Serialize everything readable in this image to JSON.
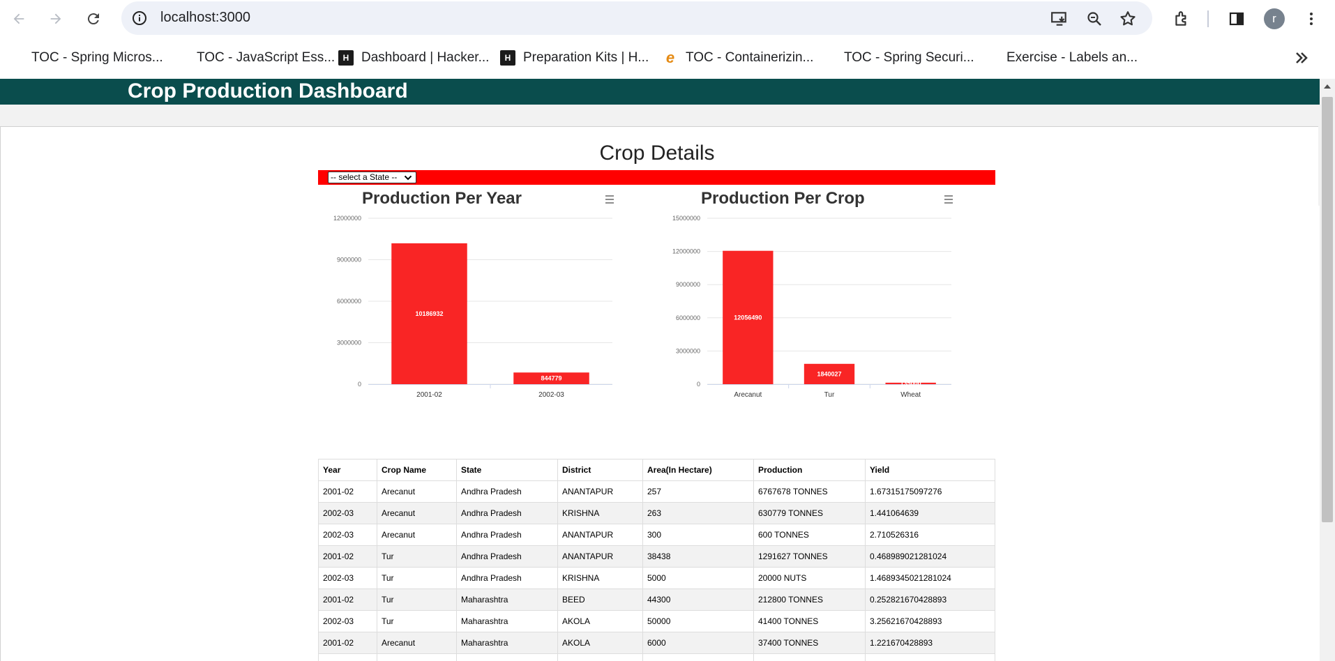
{
  "browser": {
    "url": "localhost:3000",
    "avatar_initial": "r",
    "bookmarks": [
      {
        "label": "TOC - Spring Micros...",
        "icon": "blank"
      },
      {
        "label": "TOC - JavaScript Ess...",
        "icon": "blank"
      },
      {
        "label": "Dashboard | Hacker...",
        "icon": "hackerrank-icon"
      },
      {
        "label": "Preparation Kits | H...",
        "icon": "hackerrank-icon"
      },
      {
        "label": "TOC - Containerizin...",
        "icon": "e-learning-icon"
      },
      {
        "label": "TOC - Spring Securi...",
        "icon": "blank"
      },
      {
        "label": "Exercise - Labels an...",
        "icon": "blank"
      }
    ]
  },
  "app": {
    "title": "Crop Production Dashboard",
    "section_title": "Crop Details",
    "state_select": {
      "selected": "-- select a State --"
    }
  },
  "colors": {
    "header": "#0a4d4d",
    "filter_bar": "#ff0000",
    "bar": "#f92525"
  },
  "chart_data": [
    {
      "type": "bar",
      "title": "Production Per Year",
      "categories": [
        "2001-02",
        "2002-03"
      ],
      "values": [
        10186932,
        844779
      ],
      "data_labels": [
        "10186932",
        "844779"
      ],
      "ylim": [
        0,
        12000000
      ],
      "yticks": [
        0,
        3000000,
        6000000,
        9000000,
        12000000
      ],
      "ytick_labels": [
        "0",
        "3000000",
        "6000000",
        "9000000",
        "12000000"
      ],
      "grid": true,
      "legend": "none"
    },
    {
      "type": "bar",
      "title": "Production Per Crop",
      "categories": [
        "Arecanut",
        "Tur",
        "Wheat"
      ],
      "values": [
        12056490,
        1840027,
        135000
      ],
      "data_labels": [
        "12056490",
        "1840027",
        "135000"
      ],
      "ylim": [
        0,
        15000000
      ],
      "yticks": [
        0,
        3000000,
        6000000,
        9000000,
        12000000,
        15000000
      ],
      "ytick_labels": [
        "0",
        "3000000",
        "6000000",
        "9000000",
        "12000000",
        "15000000"
      ],
      "grid": true,
      "legend": "none"
    }
  ],
  "table": {
    "columns": [
      "Year",
      "Crop Name",
      "State",
      "District",
      "Area(In Hectare)",
      "Production",
      "Yield"
    ],
    "rows": [
      [
        "2001-02",
        "Arecanut",
        "Andhra Pradesh",
        "ANANTAPUR",
        "257",
        "6767678 TONNES",
        "1.67315175097276"
      ],
      [
        "2002-03",
        "Arecanut",
        "Andhra Pradesh",
        "KRISHNA",
        "263",
        "630779 TONNES",
        "1.441064639"
      ],
      [
        "2002-03",
        "Arecanut",
        "Andhra Pradesh",
        "ANANTAPUR",
        "300",
        "600 TONNES",
        "2.710526316"
      ],
      [
        "2001-02",
        "Tur",
        "Andhra Pradesh",
        "ANANTAPUR",
        "38438",
        "1291627 TONNES",
        "0.468989021281024"
      ],
      [
        "2002-03",
        "Tur",
        "Andhra Pradesh",
        "KRISHNA",
        "5000",
        "20000 NUTS",
        "1.4689345021281024"
      ],
      [
        "2001-02",
        "Tur",
        "Maharashtra",
        "BEED",
        "44300",
        "212800 TONNES",
        "0.252821670428893"
      ],
      [
        "2002-03",
        "Tur",
        "Maharashtra",
        "AKOLA",
        "50000",
        "41400 TONNES",
        "3.25621670428893"
      ],
      [
        "2001-02",
        "Arecanut",
        "Maharashtra",
        "AKOLA",
        "6000",
        "37400 TONNES",
        "1.221670428893"
      ],
      [
        "",
        "",
        "",
        "",
        "",
        "",
        ""
      ]
    ]
  }
}
